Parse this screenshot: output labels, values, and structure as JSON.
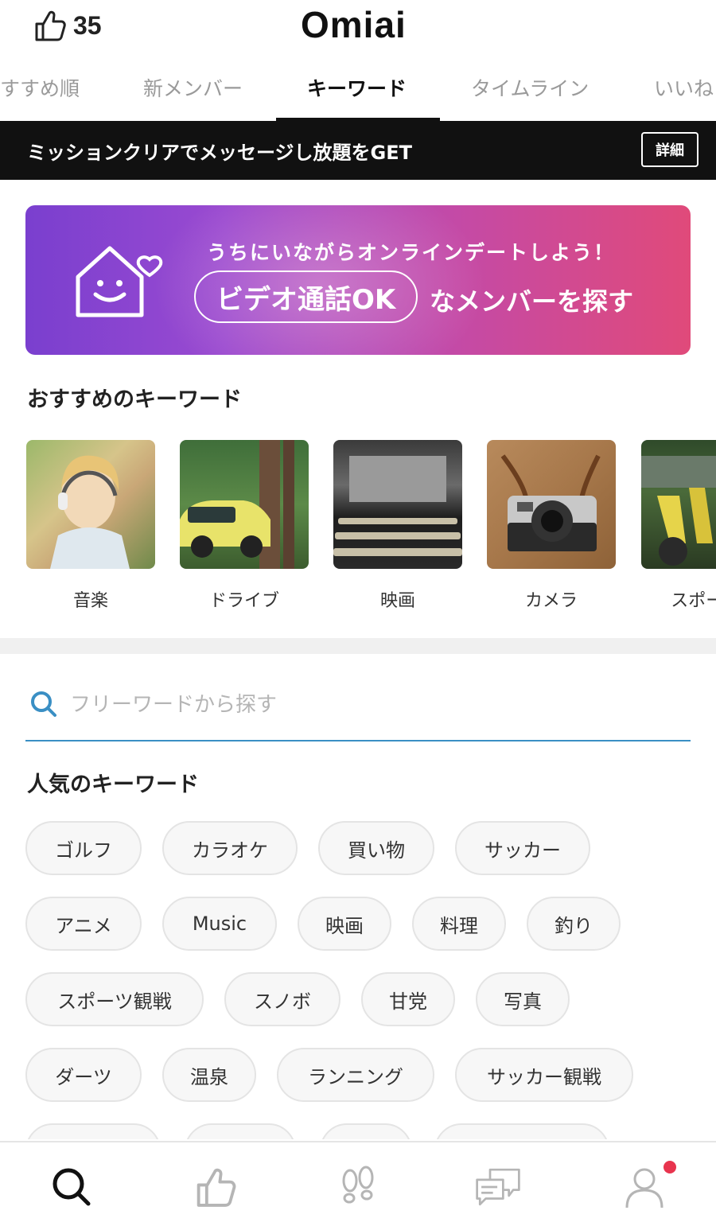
{
  "header": {
    "likes_count": "35",
    "logo": "Omiai"
  },
  "tabs": [
    {
      "label": "すすめ順",
      "active": false
    },
    {
      "label": "新メンバー",
      "active": false
    },
    {
      "label": "キーワード",
      "active": true
    },
    {
      "label": "タイムライン",
      "active": false
    },
    {
      "label": "いいね",
      "active": false
    }
  ],
  "mission": {
    "text": "ミッションクリアでメッセージし放題をGET",
    "button_label": "詳細"
  },
  "banner": {
    "line1": "うちにいながらオンラインデートしよう！",
    "pill": "ビデオ通話OK",
    "line2": "なメンバーを探す",
    "gradient_start": "#7a3fcf",
    "gradient_end": "#e04a7a"
  },
  "recommended": {
    "title": "おすすめのキーワード",
    "items": [
      {
        "label": "音楽",
        "image": "woman-headphones-photo"
      },
      {
        "label": "ドライブ",
        "image": "car-forest-photo"
      },
      {
        "label": "映画",
        "image": "movie-theater-photo"
      },
      {
        "label": "カメラ",
        "image": "camera-photo"
      },
      {
        "label": "スポーツ",
        "image": "stadium-fans-photo"
      }
    ]
  },
  "search": {
    "placeholder": "フリーワードから探す",
    "value": "",
    "accent": "#3a8fc4"
  },
  "popular": {
    "title": "人気のキーワード",
    "chips": [
      "ゴルフ",
      "カラオケ",
      "買い物",
      "サッカー",
      "アニメ",
      "Music",
      "映画",
      "料理",
      "釣り",
      "スポーツ観戦",
      "スノボ",
      "甘党",
      "写真",
      "ダーツ",
      "温泉",
      "ランニング",
      "サッカー観戦"
    ]
  },
  "bottom_nav": [
    {
      "name": "search",
      "icon": "search-icon",
      "active": true
    },
    {
      "name": "likes",
      "icon": "thumbs-up-icon",
      "active": false
    },
    {
      "name": "footprints",
      "icon": "footprints-icon",
      "active": false
    },
    {
      "name": "messages",
      "icon": "chat-icon",
      "active": false
    },
    {
      "name": "profile",
      "icon": "person-icon",
      "active": false,
      "notification": true
    }
  ],
  "colors": {
    "notification": "#e8344e",
    "mission_bg": "#111111"
  }
}
